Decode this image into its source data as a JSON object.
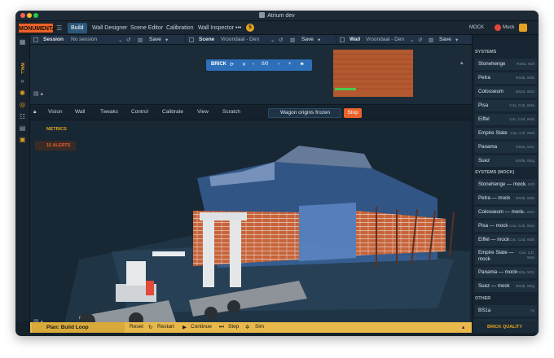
{
  "window": {
    "title": "Atrium dev"
  },
  "menubar": {
    "brand": "MONUMENTAL",
    "tabs": [
      {
        "label": "Build",
        "active": true
      },
      {
        "label": "Wall Designer",
        "active": false
      },
      {
        "label": "Scene Editor",
        "active": false
      },
      {
        "label": "Calibration",
        "active": false
      },
      {
        "label": "Wall Inspector",
        "active": false
      }
    ],
    "more": "•••",
    "badge": "5",
    "mock_label": "MOCK",
    "mock_toggle_label": "Mock"
  },
  "left_strip": {
    "label": "WALL"
  },
  "panels": {
    "session": {
      "title": "Session",
      "value": "No session",
      "save": "Save"
    },
    "scene": {
      "title": "Scene",
      "value": "Vroondaal - Den",
      "save": "Save"
    },
    "wall": {
      "title": "Wall",
      "value": "Vroondaal - Den",
      "save": "Save"
    }
  },
  "brick_bar": {
    "label": "BRICK",
    "counter": "0/0",
    "close": "✕",
    "plus": "+"
  },
  "view_bar": {
    "items": [
      "Vision",
      "Wall",
      "Tweaks",
      "Control",
      "Calibrate",
      "View",
      "Scratch"
    ],
    "status": "Wagon origins frozen",
    "stop": "Stop"
  },
  "overlay": {
    "metrics": "METRICS",
    "alerts": "15 ALERTS"
  },
  "plan_bar": {
    "title": "Plan: Build Loop",
    "reset": "Reset",
    "restart": "Restart",
    "continue": "Continue",
    "step": "Step",
    "sim": "Sim"
  },
  "sidebar": {
    "systems_title": "SYSTEMS",
    "systems": [
      {
        "name": "Stonehenge",
        "code": "RS0a, W2f"
      },
      {
        "name": "Petra",
        "code": "RS0b, W2b"
      },
      {
        "name": "Colosseum",
        "code": "BS2a, W2n"
      },
      {
        "name": "Pisa",
        "code": "C4a, C4b, W2a"
      },
      {
        "name": "Eiffel",
        "code": "C4c, C4d, W2b"
      },
      {
        "name": "Empire State",
        "code": "C4e, C4f, W2d"
      },
      {
        "name": "Panama",
        "code": "RS0a, W2c"
      },
      {
        "name": "Suez",
        "code": "RS0b, W2g"
      }
    ],
    "mock_title": "SYSTEMS (MOCK)",
    "mock_systems": [
      {
        "name": "Stonehenge — mock",
        "code": "RS0a, W2f"
      },
      {
        "name": "Petra — mock",
        "code": "RS0b, W2b"
      },
      {
        "name": "Colosseum — mock",
        "code": "BS2a, W2n"
      },
      {
        "name": "Pisa — mock",
        "code": "C4a, C4b, W2a"
      },
      {
        "name": "Eiffel — mock",
        "code": "C4c, C4d, W2b"
      },
      {
        "name": "Empire State — mock",
        "code": "C4e, C4f, W2d"
      },
      {
        "name": "Panama — mock",
        "code": "RS0a, W2c"
      },
      {
        "name": "Suez — mock",
        "code": "RS0b, W2g"
      }
    ],
    "other_title": "OTHER",
    "other": [
      {
        "name": "BS1a",
        "code": "nv"
      },
      {
        "name": "W2e",
        "code": "src-supply"
      }
    ],
    "brick_quality": "BRICK QUALITY"
  },
  "colors": {
    "accent_orange": "#e9622b",
    "accent_yellow": "#e5a321",
    "active_tab": "#2b5678",
    "brick_bar_blue": "#2d6fb8",
    "plan_bar": "#e8b84a"
  }
}
